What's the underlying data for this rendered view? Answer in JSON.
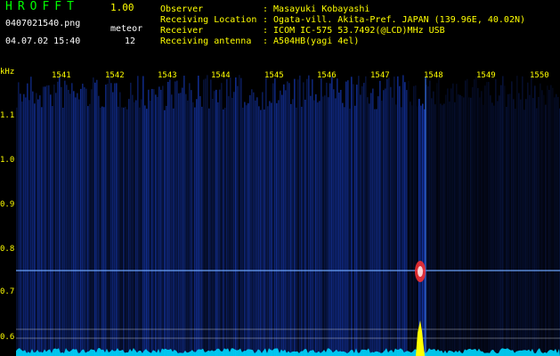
{
  "header": {
    "app_title": "HROFFT",
    "app_version": "1.00",
    "filename": "0407021540.png",
    "timestamp": "04.07.02 15:40",
    "meteor_label": "meteor",
    "meteor_count": "12",
    "fields": [
      {
        "label": "Observer",
        "value": ": Masayuki Kobayashi"
      },
      {
        "label": "Receiving Location",
        "value": ": Ogata-vill. Akita-Pref. JAPAN (139.96E, 40.02N)"
      },
      {
        "label": "Receiver",
        "value": ": ICOM IC-575 53.7492(@LCD)MHz USB"
      },
      {
        "label": "Receiving antenna",
        "value": ": A504HB(yagi 4el)"
      }
    ]
  },
  "chart_data": {
    "type": "heatmap",
    "ylabel": "kHz",
    "yticks": [
      "1.1",
      "1.0",
      "0.9",
      "0.8",
      "0.7",
      "0.6"
    ],
    "xticks": [
      "1541",
      "1542",
      "1543",
      "1544",
      "1545",
      "1546",
      "1547",
      "1548",
      "1549",
      "1550"
    ],
    "colors": {
      "background": "#000000",
      "noise": "#1e50ff",
      "signal": "#ff3030",
      "spectrum": "#00d8ff",
      "meteor_peak": "#ffff00",
      "labels": "#ffff00",
      "grid": "#ffffff"
    }
  }
}
